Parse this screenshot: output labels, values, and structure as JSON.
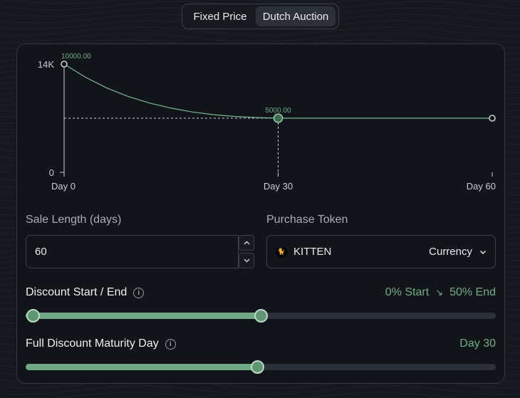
{
  "toggle": {
    "options": [
      "Fixed Price",
      "Dutch Auction"
    ],
    "selected": "Dutch Auction"
  },
  "chart_data": {
    "type": "line",
    "y_ticks": [
      "14K",
      "0"
    ],
    "x_ticks": [
      "Day 0",
      "Day 30",
      "Day 60"
    ],
    "x_range": [
      0,
      60
    ],
    "y_range": [
      0,
      14000
    ],
    "points": [
      {
        "x": 0,
        "y": 14000,
        "label": "10000.00"
      },
      {
        "x": 30,
        "y": 7000,
        "label": "5000.00"
      },
      {
        "x": 60,
        "y": 7000,
        "label": ""
      }
    ],
    "curve": [
      [
        0,
        14000
      ],
      [
        3,
        12300
      ],
      [
        6,
        10900
      ],
      [
        9,
        9800
      ],
      [
        12,
        8950
      ],
      [
        15,
        8300
      ],
      [
        18,
        7800
      ],
      [
        21,
        7450
      ],
      [
        24,
        7220
      ],
      [
        27,
        7080
      ],
      [
        30,
        7000
      ],
      [
        45,
        7000
      ],
      [
        60,
        7000
      ]
    ],
    "reference_line": {
      "y": 7000,
      "x_marker": 30
    },
    "colors": {
      "line": "#7cb893",
      "axis": "#c9ccd1",
      "label": "#6fae86"
    }
  },
  "sale_length": {
    "label": "Sale Length (days)",
    "value": "60"
  },
  "purchase_token": {
    "label": "Purchase Token",
    "token": "KITTEN",
    "type": "Currency"
  },
  "discount": {
    "title": "Discount Start / End",
    "start_text": "0% Start",
    "end_text": "50% End",
    "start_fraction": 0,
    "end_fraction": 0.5
  },
  "maturity": {
    "title": "Full Discount Maturity Day",
    "value_text": "Day 30",
    "fraction": 0.5
  },
  "colors": {
    "accent": "#6fae86",
    "background": "#15181c",
    "panel": "#111418",
    "border": "#353a42"
  }
}
